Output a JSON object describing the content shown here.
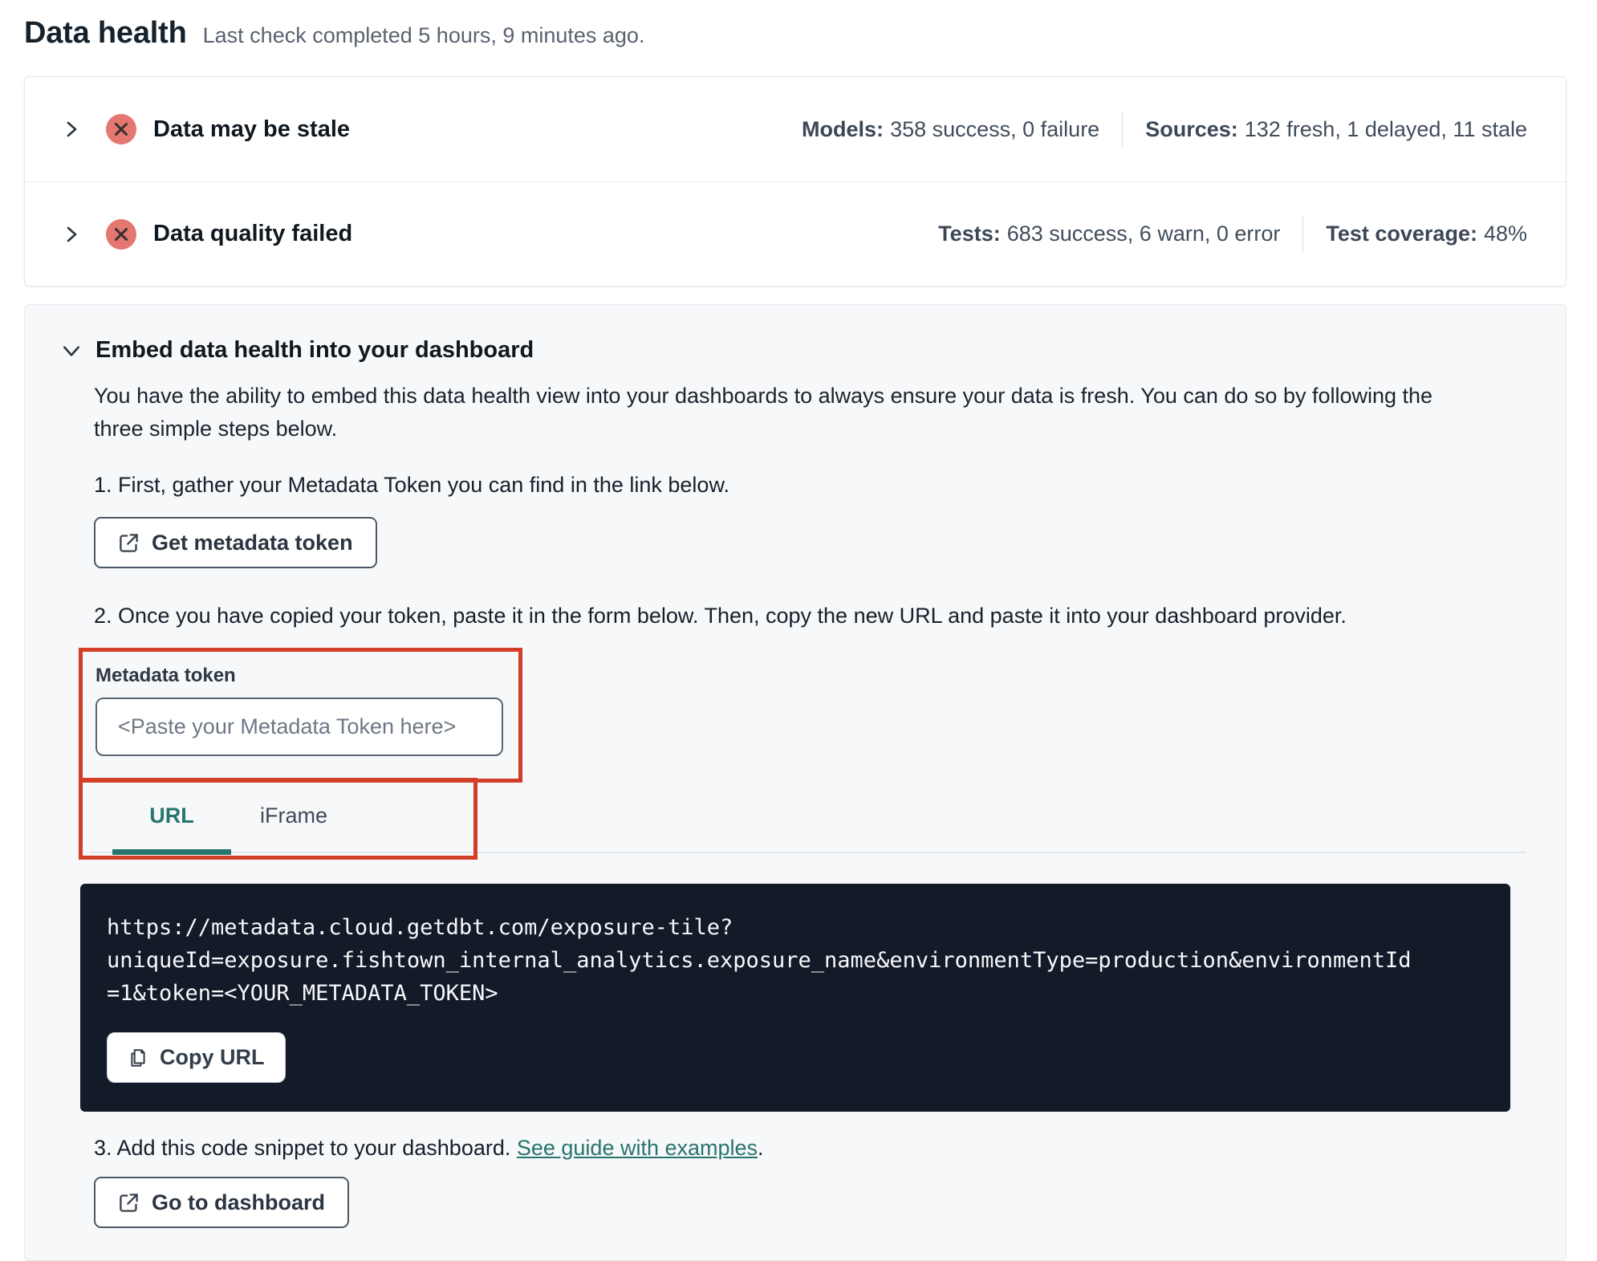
{
  "page": {
    "title": "Data health",
    "subtitle": "Last check completed 5 hours, 9 minutes ago."
  },
  "status_cards": [
    {
      "title": "Data may be stale",
      "stats": [
        {
          "label": "Models:",
          "value": "358 success, 0 failure"
        },
        {
          "label": "Sources:",
          "value": "132 fresh, 1 delayed, 11 stale"
        }
      ]
    },
    {
      "title": "Data quality failed",
      "stats": [
        {
          "label": "Tests:",
          "value": "683 success, 6 warn, 0 error"
        },
        {
          "label": "Test coverage:",
          "value": "48%"
        }
      ]
    }
  ],
  "embed": {
    "title": "Embed data health into your dashboard",
    "description": "You have the ability to embed this data health view into your dashboards to always ensure your data is fresh. You can do so by following the three simple steps below.",
    "step1": "1. First, gather your Metadata Token you can find in the link below.",
    "get_token_button": "Get metadata token",
    "step2": "2. Once you have copied your token, paste it in the form below. Then, copy the new URL and paste it into your dashboard provider.",
    "token_field": {
      "label": "Metadata token",
      "placeholder": "<Paste your Metadata Token here>"
    },
    "tabs": [
      {
        "label": "URL"
      },
      {
        "label": "iFrame"
      }
    ],
    "code_url": "https://metadata.cloud.getdbt.com/exposure-tile?uniqueId=exposure.fishtown_internal_analytics.exposure_name&environmentType=production&environmentId=1&token=<YOUR_METADATA_TOKEN>",
    "copy_button": "Copy URL",
    "step3_prefix": "3. Add this code snippet to your dashboard. ",
    "step3_link": "See guide with examples",
    "step3_suffix": ".",
    "dashboard_button": "Go to dashboard"
  },
  "colors": {
    "accent_teal": "#27756c",
    "error_red": "#e4776f",
    "annotation_red": "#d23e28",
    "code_background": "#131a28"
  }
}
